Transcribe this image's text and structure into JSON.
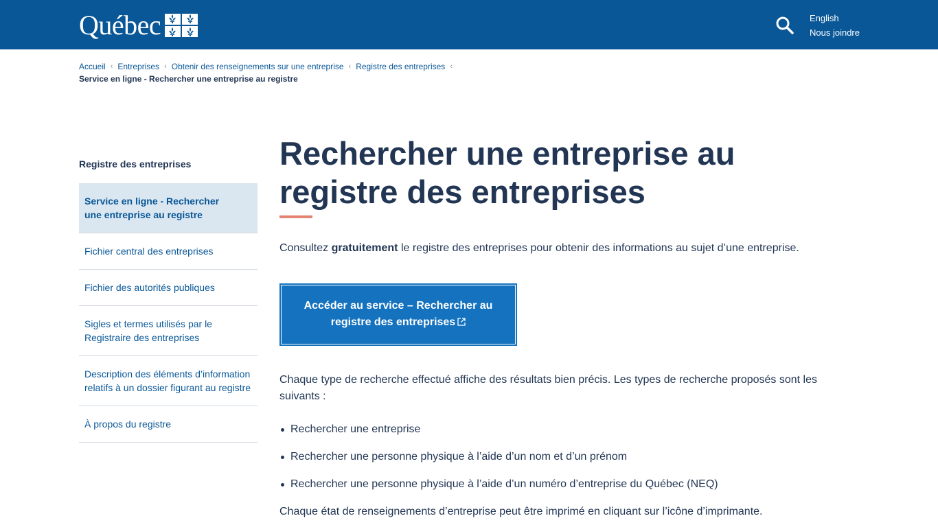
{
  "header": {
    "logo_text": "Québec",
    "links": [
      "English",
      "Nous joindre"
    ],
    "icons": [
      "fleur-de-lis-flag-icon",
      "search-icon"
    ]
  },
  "breadcrumb": {
    "items": [
      "Accueil",
      "Entreprises",
      "Obtenir des renseignements sur une entreprise",
      "Registre des entreprises"
    ],
    "current": "Service en ligne - Rechercher une entreprise au registre"
  },
  "sidebar": {
    "title": "Registre des entreprises",
    "items": [
      {
        "label": "Service en ligne - Rechercher une entreprise au registre",
        "active": true
      },
      {
        "label": "Fichier central des entreprises",
        "active": false
      },
      {
        "label": "Fichier des autorités publiques",
        "active": false
      },
      {
        "label": "Sigles et termes utilisés par le Registraire des entreprises",
        "active": false
      },
      {
        "label": "Description des éléments d’information relatifs à un dossier figurant au registre",
        "active": false
      },
      {
        "label": "À propos du registre",
        "active": false
      }
    ]
  },
  "main": {
    "title": "Rechercher une entreprise au registre des entreprises",
    "intro_prefix": "Consultez ",
    "intro_bold": "gratuitement",
    "intro_suffix": " le registre des entreprises pour obtenir des informations au sujet d’une entreprise.",
    "cta_label": "Accéder au service – Rechercher au registre des entreprises",
    "paragraph1": "Chaque type de recherche effectué affiche des résultats bien précis. Les types de recherche proposés sont les suivants :",
    "bullets": [
      "Rechercher une entreprise",
      "Rechercher une personne physique à l’aide d’un nom et d’un prénom",
      "Rechercher une personne physique à l’aide d’un numéro d’entreprise du Québec (NEQ)"
    ],
    "paragraph2": "Chaque état de renseignements d’entreprise peut être imprimé en cliquant sur l’icône d’imprimante."
  },
  "colors": {
    "header_blue": "#095797",
    "title_dark": "#223654",
    "accent_underline": "#e58271",
    "cta_blue": "#1472bf",
    "active_bg": "#dae6f0"
  }
}
